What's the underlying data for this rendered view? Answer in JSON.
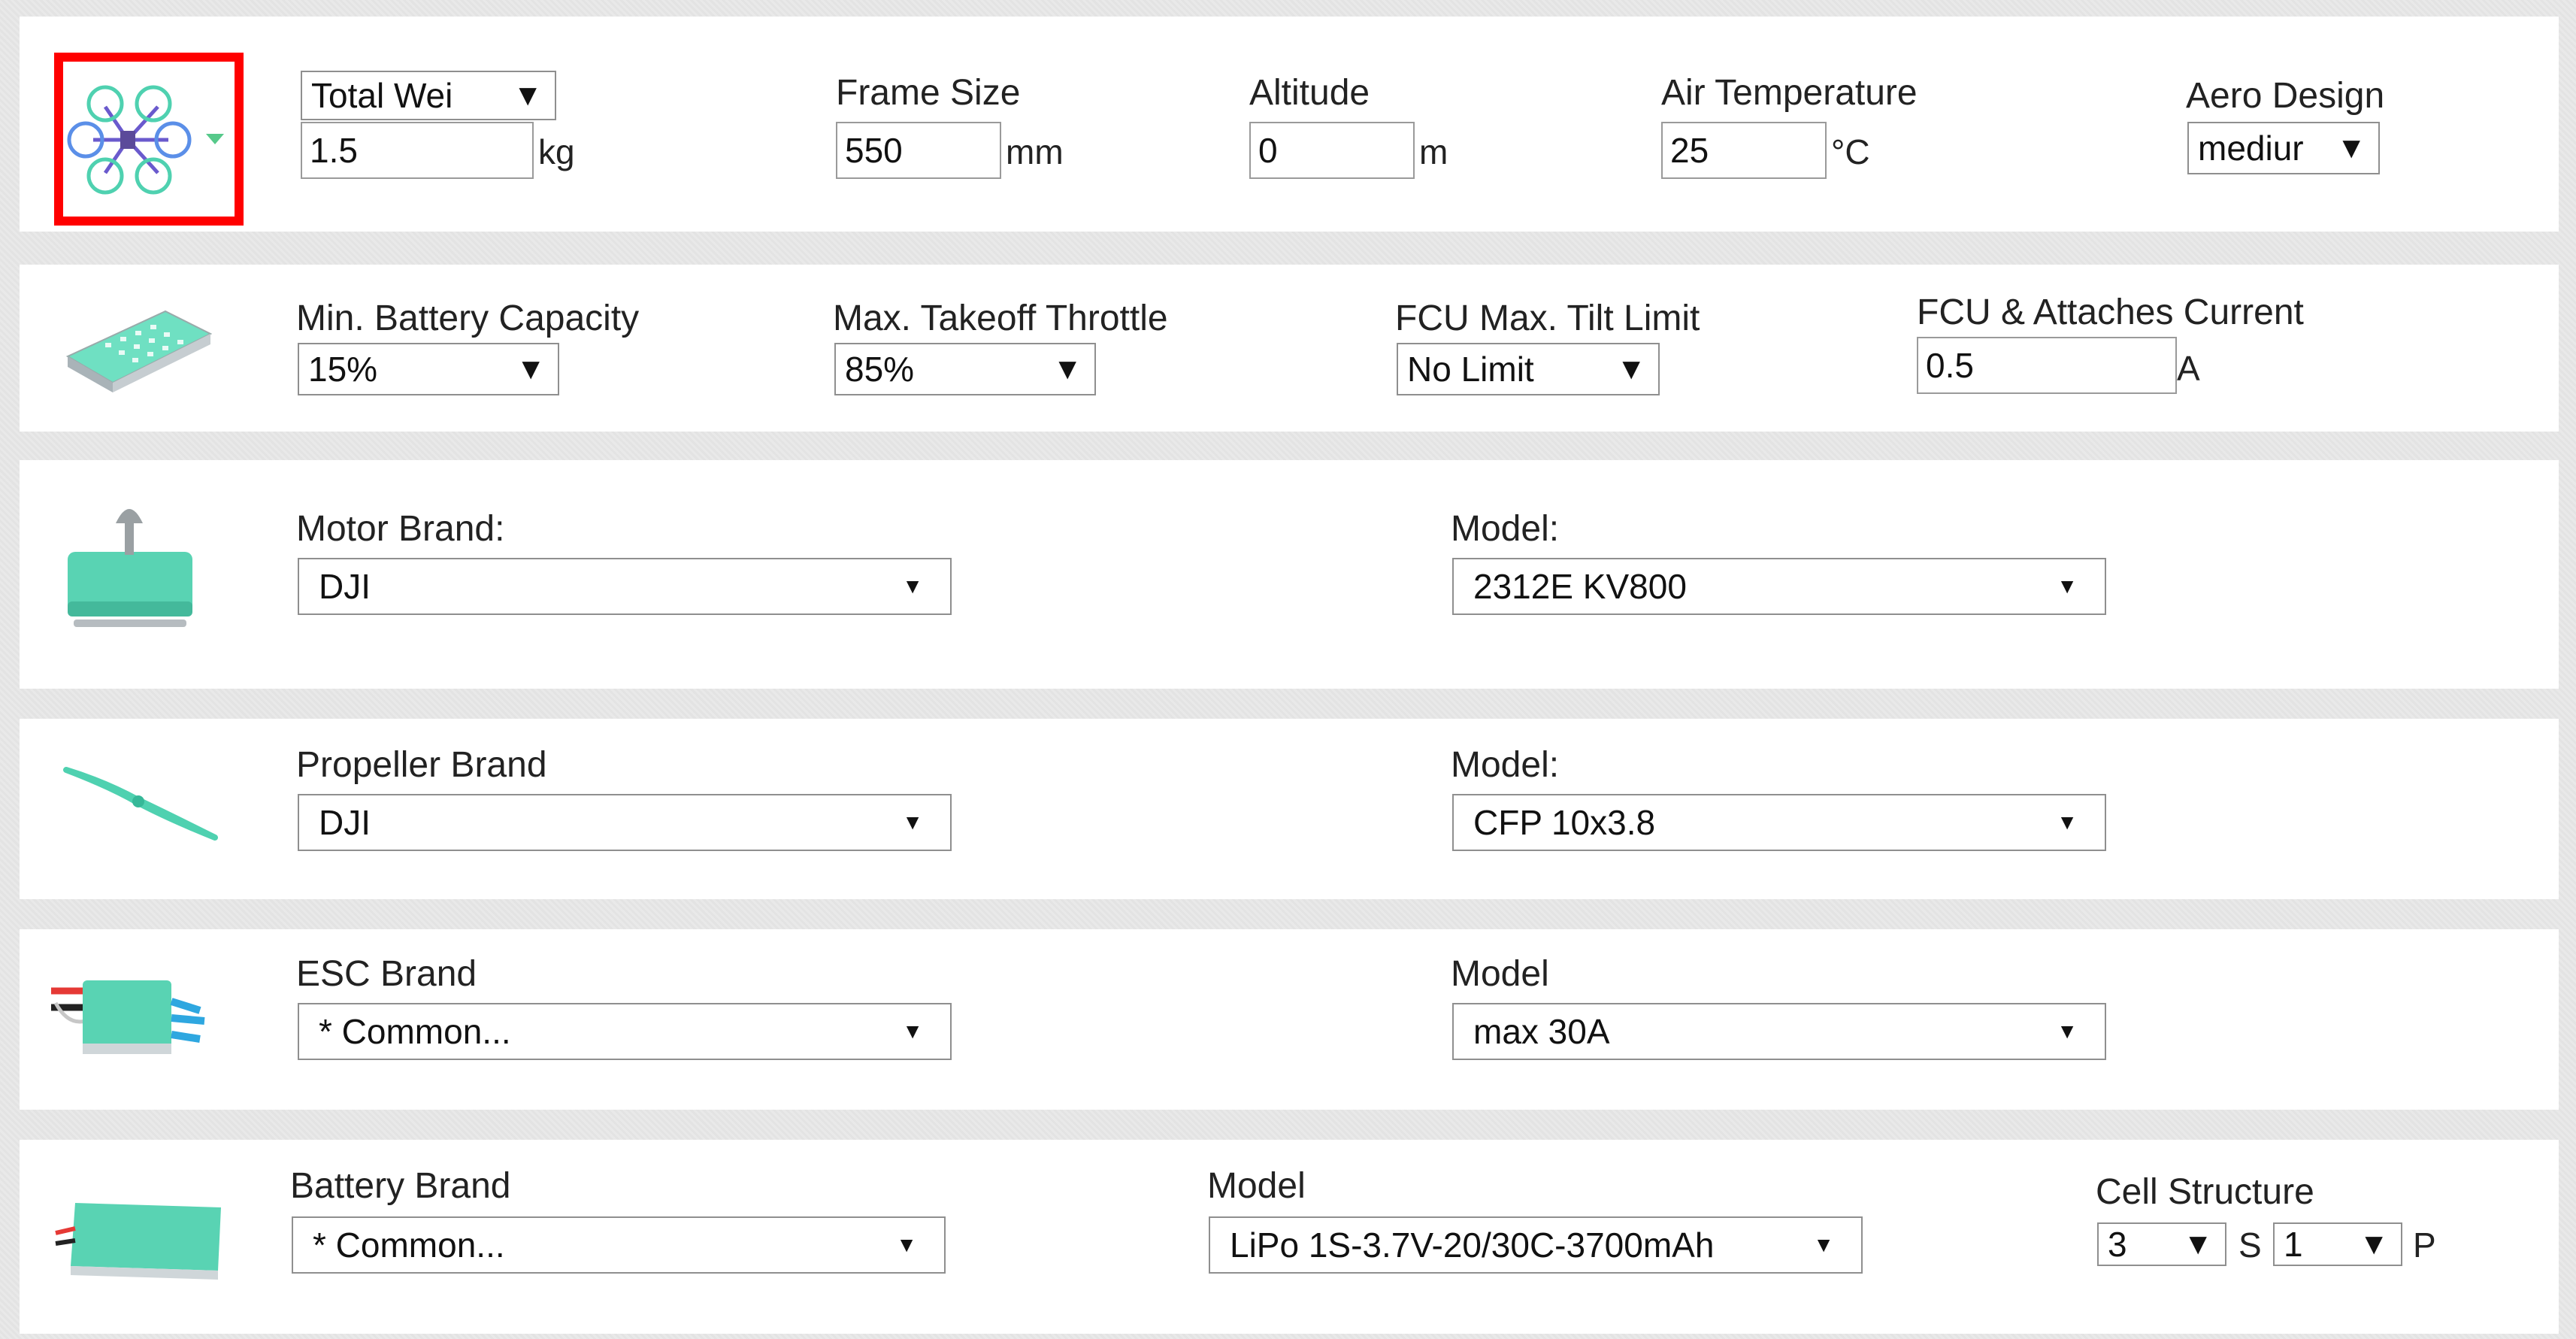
{
  "row1": {
    "total_weight_select": "Total Wei",
    "total_weight_value": "1.5",
    "total_weight_unit": "kg",
    "frame_size_label": "Frame Size",
    "frame_size_value": "550",
    "frame_size_unit": "mm",
    "altitude_label": "Altitude",
    "altitude_value": "0",
    "altitude_unit": "m",
    "air_temp_label": "Air Temperature",
    "air_temp_value": "25",
    "air_temp_unit": "°C",
    "aero_design_label": "Aero Design",
    "aero_design_value": "mediur"
  },
  "row2": {
    "min_battery_label": "Min. Battery Capacity",
    "min_battery_value": "15%",
    "max_throttle_label": "Max. Takeoff Throttle",
    "max_throttle_value": "85%",
    "tilt_label": "FCU Max. Tilt Limit",
    "tilt_value": "No Limit",
    "fcu_current_label": "FCU & Attaches Current",
    "fcu_current_value": "0.5",
    "fcu_current_unit": "A"
  },
  "row3": {
    "motor_brand_label": "Motor Brand:",
    "motor_brand_value": "DJI",
    "motor_model_label": "Model:",
    "motor_model_value": "2312E KV800"
  },
  "row4": {
    "prop_brand_label": "Propeller Brand",
    "prop_brand_value": "DJI",
    "prop_model_label": "Model:",
    "prop_model_value": "CFP 10x3.8"
  },
  "row5": {
    "esc_brand_label": "ESC Brand",
    "esc_brand_value": "* Common...",
    "esc_model_label": "Model",
    "esc_model_value": "max 30A"
  },
  "row6": {
    "battery_brand_label": "Battery Brand",
    "battery_brand_value": "* Common...",
    "battery_model_label": "Model",
    "battery_model_value": "LiPo 1S-3.7V-20/30C-3700mAh",
    "cell_structure_label": "Cell Structure",
    "cell_s_value": "3",
    "cell_s_label": "S",
    "cell_p_value": "1",
    "cell_p_label": "P"
  },
  "glyphs": {
    "dropdown_arrow": "▼",
    "small_arrow": "▼"
  },
  "colors": {
    "accent_teal": "#4fd1b0",
    "highlight_red": "#ff0000",
    "frame_blue": "#5b8fe8"
  },
  "icons": {
    "row1": "hexacopter-frame-icon",
    "row2": "battery-board-icon",
    "row3": "motor-icon",
    "row4": "propeller-icon",
    "row5": "esc-icon",
    "row6": "battery-pack-icon"
  }
}
